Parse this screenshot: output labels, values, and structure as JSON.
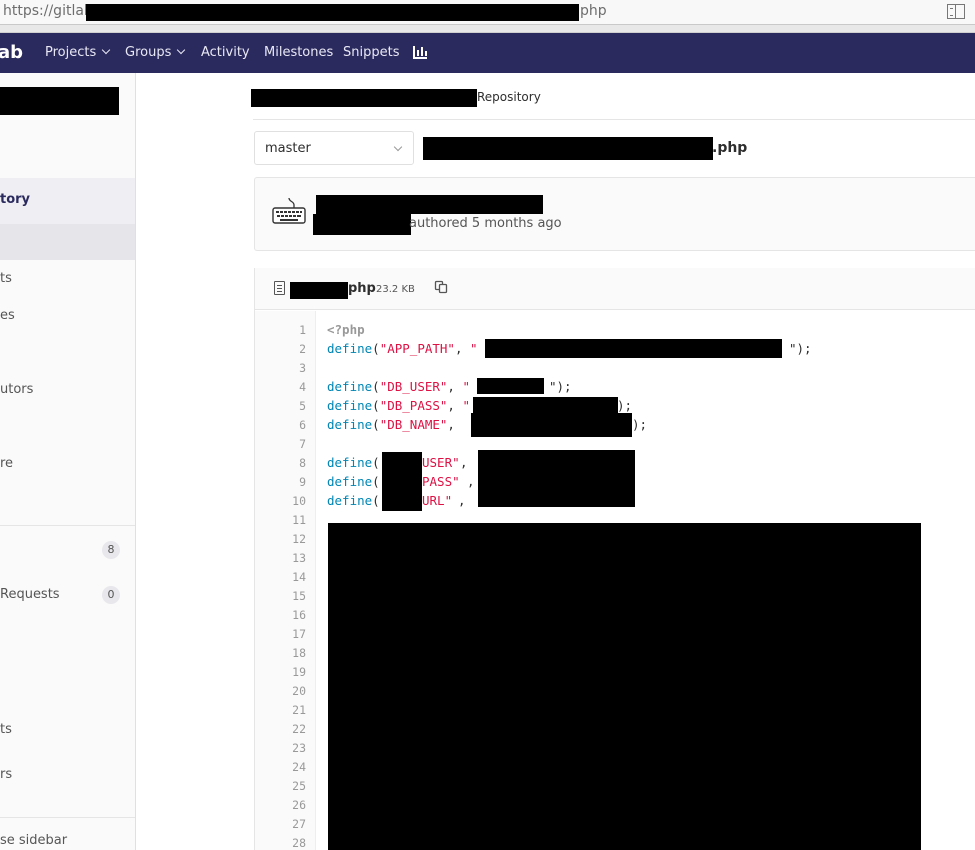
{
  "browser": {
    "url_prefix": "https://gitlab",
    "url_suffix": "php"
  },
  "nav": {
    "brand": "ab",
    "projects": "Projects",
    "groups": "Groups",
    "activity": "Activity",
    "milestones": "Milestones",
    "snippets": "Snippets",
    "chart_icon": "chart-icon"
  },
  "sidebar": {
    "repository": "tory",
    "items": [
      "ts",
      "es",
      "utors",
      "re"
    ],
    "issues_count": "8",
    "merge_requests": "Requests",
    "merge_requests_count": "0",
    "lower_items": [
      "ts",
      "rs"
    ],
    "collapse": "se sidebar"
  },
  "breadcrumb": {
    "current": "Repository"
  },
  "branch": {
    "selected": "master"
  },
  "file_path": {
    "ext": ".php"
  },
  "commit": {
    "meta": "authored 5 months ago"
  },
  "file": {
    "ext": "php",
    "size": "23.2 KB"
  },
  "code": {
    "line_numbers": [
      "1",
      "2",
      "3",
      "4",
      "5",
      "6",
      "7",
      "8",
      "9",
      "10",
      "11",
      "12",
      "13",
      "14",
      "15",
      "16",
      "17",
      "18",
      "19",
      "20",
      "21",
      "22",
      "23",
      "24",
      "25",
      "26",
      "27",
      "28"
    ],
    "l1": "<?php",
    "fn": "define",
    "l2_key": "\"APP_PATH\"",
    "l2_tail": "\");",
    "l4_key": "\"DB_USER\"",
    "l4_tail": "\");",
    "l5_key": "\"DB_PASS\"",
    "l5_tail": ");",
    "l6_key": "\"DB_NAME\"",
    "l6_tail": ");",
    "l8_key": "USER\"",
    "l9_key": "PASS\"",
    "l10_key": "URL\""
  }
}
